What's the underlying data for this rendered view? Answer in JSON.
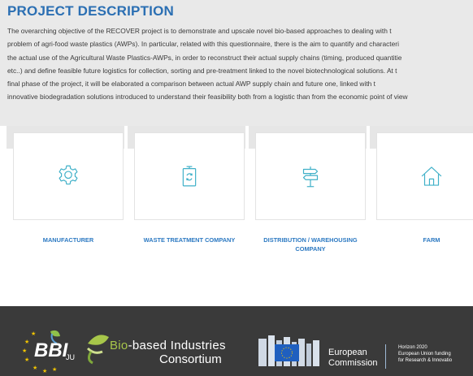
{
  "section": {
    "title": "PROJECT DESCRIPTION",
    "lines": [
      "The overarching objective of the RECOVER project is to demonstrate and upscale novel bio-based approaches to dealing with t",
      "problem of agri-food waste plastics (AWPs). In particular, related with this questionnaire, there is the aim to quantify and characteri",
      "the actual use of the Agricultural Waste Plastics-AWPs, in order to reconstruct their actual supply chains (timing, produced quantitie",
      "etc..) and define feasible future logistics for collection, sorting and pre-treatment linked to the novel biotechnological solutions. At t",
      "final phase of the project, it will be elaborated a comparison between actual AWP supply chain and future one, linked with t",
      "innovative biodegradation solutions introduced to understand their feasibility both from a logistic than from the economic point of view"
    ]
  },
  "cards": [
    {
      "label": "MANUFACTURER",
      "icon": "gear-icon"
    },
    {
      "label": "WASTE TREATMENT COMPANY",
      "icon": "recycle-bin-icon"
    },
    {
      "label": "DISTRIBUTION / WAREHOUSING COMPANY",
      "icon": "signpost-icon"
    },
    {
      "label": "FARM",
      "icon": "house-icon"
    }
  ],
  "footer": {
    "bbi": {
      "text": "BBI",
      "sub": "JU"
    },
    "bic": {
      "line1_accent": "Bio",
      "line1_rest": "-based Industries",
      "line2": "Consortium"
    },
    "ec": {
      "line1": "European",
      "line2": "Commission"
    },
    "horizon": {
      "line1": "Horizon 2020",
      "line2": "European Union funding",
      "line3": "for Research & Innovatio"
    }
  },
  "colors": {
    "title": "#2b6fb3",
    "card_label": "#2c79c2",
    "icon": "#3fb0c8",
    "footer_bg": "#3a3a3a",
    "bic_green": "#a7c64a"
  }
}
